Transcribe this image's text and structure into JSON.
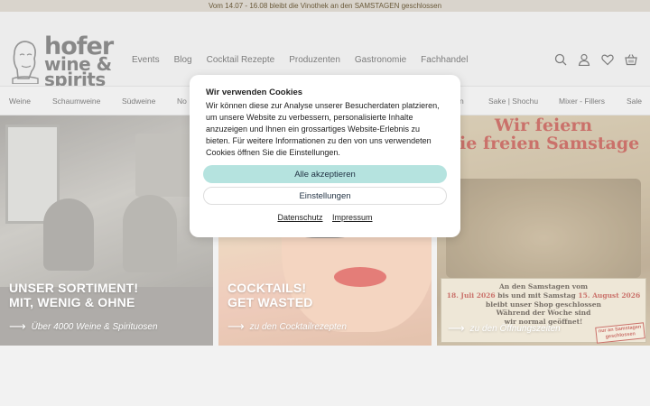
{
  "announcement": "Vom 14.07 - 16.08 bleibt die Vinothek an den SAMSTAGEN geschlossen",
  "logo": {
    "line1": "hofer",
    "line2": "wine &",
    "line3": "spirits"
  },
  "main_nav": [
    "Events",
    "Blog",
    "Cocktail Rezepte",
    "Produzenten",
    "Gastronomie",
    "Fachhandel"
  ],
  "header_icons": [
    "search-icon",
    "user-icon",
    "heart-icon",
    "basket-icon"
  ],
  "category_nav": [
    "Weine",
    "Schaumweine",
    "Südweine",
    "No",
    "n",
    "Sake | Shochu",
    "Mixer - Fillers",
    "Sale"
  ],
  "tiles": [
    {
      "title_line1": "UNSER SORTIMENT!",
      "title_line2": "MIT, WENIG & OHNE",
      "link": "Über 4000 Weine & Spirituosen"
    },
    {
      "title_line1": "COCKTAILS!",
      "title_line2": "GET WASTED",
      "link": "zu den Cocktailrezepten"
    },
    {
      "poster_line1": "Wir feiern",
      "poster_line2": "die freien Samstage",
      "notice_line1": "An den Samstagen vom",
      "notice_line2a": "18. Juli 2026",
      "notice_line2b": " bis und mit Samstag ",
      "notice_line2c": "15. August 2026",
      "notice_line3": "bleibt unser Shop geschlossen",
      "notice_line4": "Während der Woche sind",
      "notice_line5": "wir normal geöffnet!",
      "stamp": "nur an Samstagen geschlossen",
      "link": "zu den Öffnungszeiten"
    }
  ],
  "cookie_modal": {
    "title": "Wir verwenden Cookies",
    "body": "Wir können diese zur Analyse unserer Besucherdaten platzieren, um unsere Website zu verbessern, personalisierte Inhalte anzuzeigen und Ihnen ein grossartiges Website-Erlebnis zu bieten. Für weitere Informationen zu den von uns verwendeten Cookies öffnen Sie die Einstellungen.",
    "accept_label": "Alle akzeptieren",
    "settings_label": "Einstellungen",
    "privacy_link": "Datenschutz",
    "imprint_link": "Impressum"
  },
  "colors": {
    "accept_button": "#b5e3df",
    "announcement_bg": "#d9d4cc",
    "poster_red": "#b3342a"
  }
}
